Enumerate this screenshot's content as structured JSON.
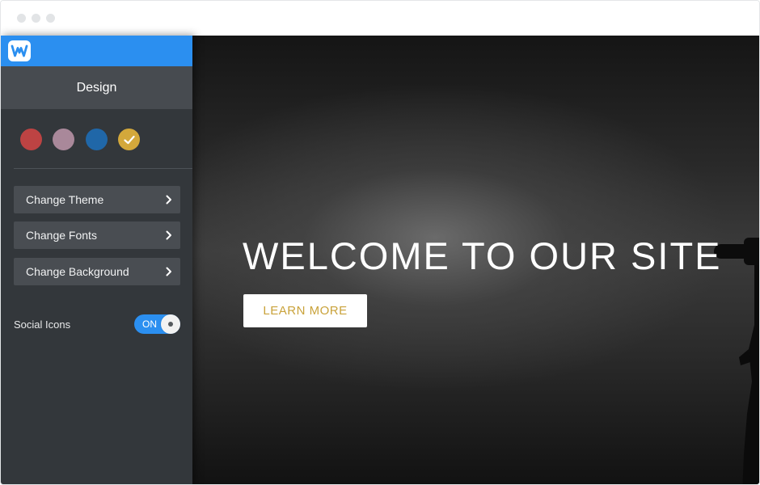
{
  "sidebar": {
    "header_title": "Design",
    "color_swatches": [
      {
        "name": "red",
        "color": "#bd4343",
        "selected": false
      },
      {
        "name": "mauve",
        "color": "#a9889a",
        "selected": false
      },
      {
        "name": "blue",
        "color": "#2067a8",
        "selected": false
      },
      {
        "name": "gold",
        "color": "#d3a83b",
        "selected": true
      }
    ],
    "menu_items": [
      {
        "label": "Change Theme",
        "icon": "chevron-right-icon"
      },
      {
        "label": "Change Fonts",
        "icon": "chevron-right-icon"
      },
      {
        "label": "Change Background",
        "icon": "chevron-right-icon"
      }
    ],
    "social_icons": {
      "label": "Social Icons",
      "toggle_text": "ON",
      "enabled": true
    }
  },
  "hero": {
    "title": "WELCOME TO OUR SITE",
    "button_label": "LEARN MORE"
  },
  "colors": {
    "brand_blue": "#2b8ff0",
    "sidebar_bg": "#33373b",
    "accent_gold": "#c9a23a"
  }
}
